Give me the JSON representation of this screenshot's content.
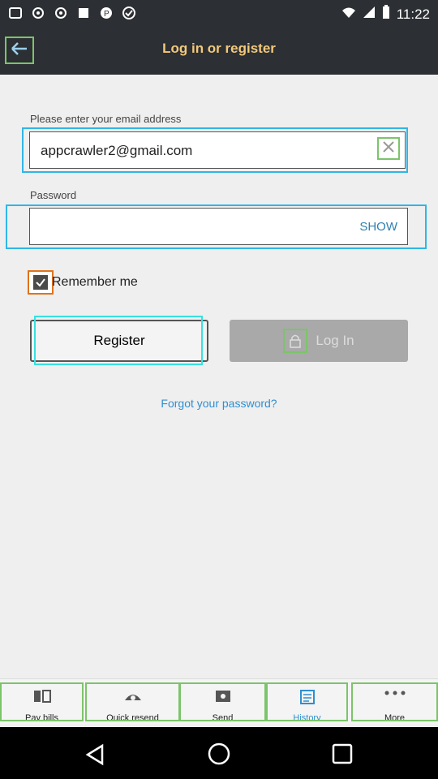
{
  "status_bar": {
    "time": "11:22"
  },
  "appbar": {
    "title": "Log in or register"
  },
  "email": {
    "label": "Please enter your email address",
    "value": "appcrawler2@gmail.com"
  },
  "password": {
    "label": "Password",
    "show_label": "SHOW"
  },
  "remember": {
    "label": "Remember me",
    "checked": true
  },
  "buttons": {
    "register": "Register",
    "login": "Log In"
  },
  "forgot_link": "Forgot your password?",
  "bottom_nav": {
    "items": [
      {
        "label": "Pay bills",
        "icon": "bills-icon"
      },
      {
        "label": "Quick resend",
        "icon": "quick-resend-icon"
      },
      {
        "label": "Send",
        "icon": "send-icon"
      },
      {
        "label": "History",
        "icon": "history-icon"
      },
      {
        "label": "More",
        "icon": "more-dots-icon"
      }
    ]
  },
  "colors": {
    "accent_blue": "#2fb6e6",
    "title_gold": "#f3c97a",
    "appbar": "#2c2f33",
    "link_blue": "#2f8fd0"
  }
}
